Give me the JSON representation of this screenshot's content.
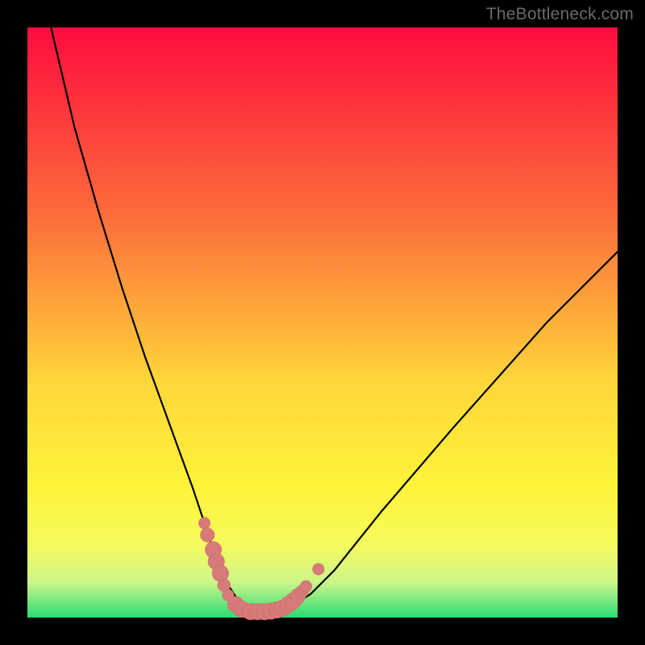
{
  "watermark": {
    "text": "TheBottleneck.com"
  },
  "colors": {
    "black": "#000000",
    "curve": "#000000",
    "marker_fill": "#d77a7a",
    "marker_stroke": "#c96666",
    "grad_top": "#fe0c3d",
    "grad_mid1": "#fd6d3b",
    "grad_mid2": "#ffd63a",
    "grad_mid3": "#fff439",
    "grad_mid4": "#f3fa5e",
    "grad_mid5": "#cdf58a",
    "grad_bottom": "#2adc74"
  },
  "chart_data": {
    "type": "line",
    "title": "",
    "xlabel": "",
    "ylabel": "",
    "xlim": [
      0,
      100
    ],
    "ylim": [
      0,
      100
    ],
    "series": [
      {
        "name": "bottleneck-curve",
        "x": [
          4,
          8,
          12,
          16,
          20,
          24,
          28,
          30,
          32,
          34,
          36,
          38,
          40,
          44,
          48,
          52,
          56,
          60,
          66,
          72,
          80,
          88,
          96,
          100
        ],
        "y": [
          100,
          83,
          69,
          56,
          44,
          33,
          22,
          16,
          10,
          5.5,
          2.5,
          1,
          1,
          1.5,
          4,
          8,
          13,
          18,
          25,
          32,
          41,
          50,
          58,
          62
        ]
      }
    ],
    "markers": [
      {
        "x": 30.0,
        "y": 16.0,
        "r": 1.0
      },
      {
        "x": 30.5,
        "y": 14.0,
        "r": 1.2
      },
      {
        "x": 31.5,
        "y": 11.5,
        "r": 1.4
      },
      {
        "x": 32.0,
        "y": 9.5,
        "r": 1.4
      },
      {
        "x": 32.7,
        "y": 7.5,
        "r": 1.4
      },
      {
        "x": 33.3,
        "y": 5.5,
        "r": 1.1
      },
      {
        "x": 34.0,
        "y": 3.8,
        "r": 1.0
      },
      {
        "x": 35.3,
        "y": 2.2,
        "r": 1.4
      },
      {
        "x": 36.3,
        "y": 1.4,
        "r": 1.4
      },
      {
        "x": 37.8,
        "y": 1.0,
        "r": 1.4
      },
      {
        "x": 39.0,
        "y": 1.0,
        "r": 1.4
      },
      {
        "x": 40.2,
        "y": 1.0,
        "r": 1.4
      },
      {
        "x": 41.3,
        "y": 1.1,
        "r": 1.4
      },
      {
        "x": 42.3,
        "y": 1.3,
        "r": 1.4
      },
      {
        "x": 43.3,
        "y": 1.6,
        "r": 1.4
      },
      {
        "x": 44.2,
        "y": 2.2,
        "r": 1.4
      },
      {
        "x": 45.0,
        "y": 2.8,
        "r": 1.4
      },
      {
        "x": 45.8,
        "y": 3.6,
        "r": 1.3
      },
      {
        "x": 46.5,
        "y": 4.4,
        "r": 1.1
      },
      {
        "x": 47.2,
        "y": 5.3,
        "r": 1.0
      },
      {
        "x": 49.3,
        "y": 8.2,
        "r": 1.0
      }
    ]
  }
}
